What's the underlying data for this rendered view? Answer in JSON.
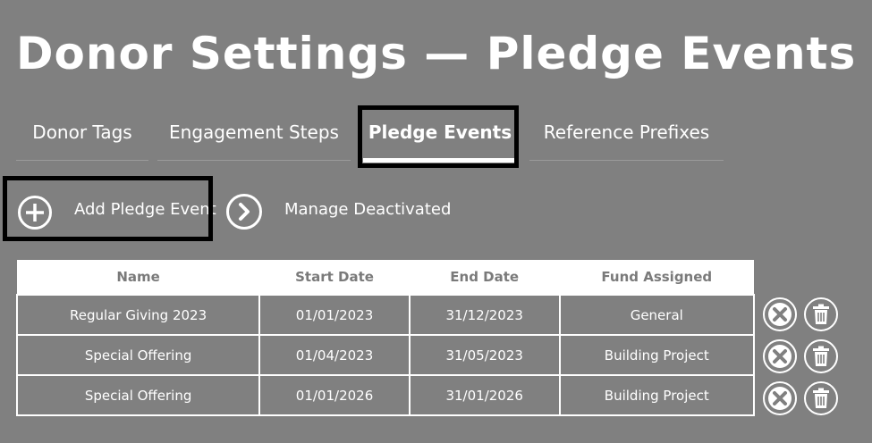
{
  "page": {
    "title": "Donor Settings — Pledge Events"
  },
  "tabs": [
    {
      "label": "Donor Tags"
    },
    {
      "label": "Engagement Steps"
    },
    {
      "label": "Pledge Events"
    },
    {
      "label": "Reference Prefixes"
    }
  ],
  "actions": {
    "add_label": "Add Pledge Event",
    "manage_label": "Manage Deactivated"
  },
  "table": {
    "headers": [
      "Name",
      "Start Date",
      "End Date",
      "Fund Assigned"
    ],
    "rows": [
      [
        "Regular Giving 2023",
        "01/01/2023",
        "31/12/2023",
        "General"
      ],
      [
        "Special Offering",
        "01/04/2023",
        "31/05/2023",
        "Building Project"
      ],
      [
        "Special Offering",
        "01/01/2026",
        "31/01/2026",
        "Building Project"
      ]
    ]
  },
  "icons": {
    "add": "plus-circle-icon",
    "manage": "chevron-right-circle-icon",
    "deactivate": "close-circle-icon",
    "delete": "trash-icon"
  },
  "colors": {
    "background": "#808080",
    "foreground": "#ffffff",
    "highlight": "#000000"
  }
}
